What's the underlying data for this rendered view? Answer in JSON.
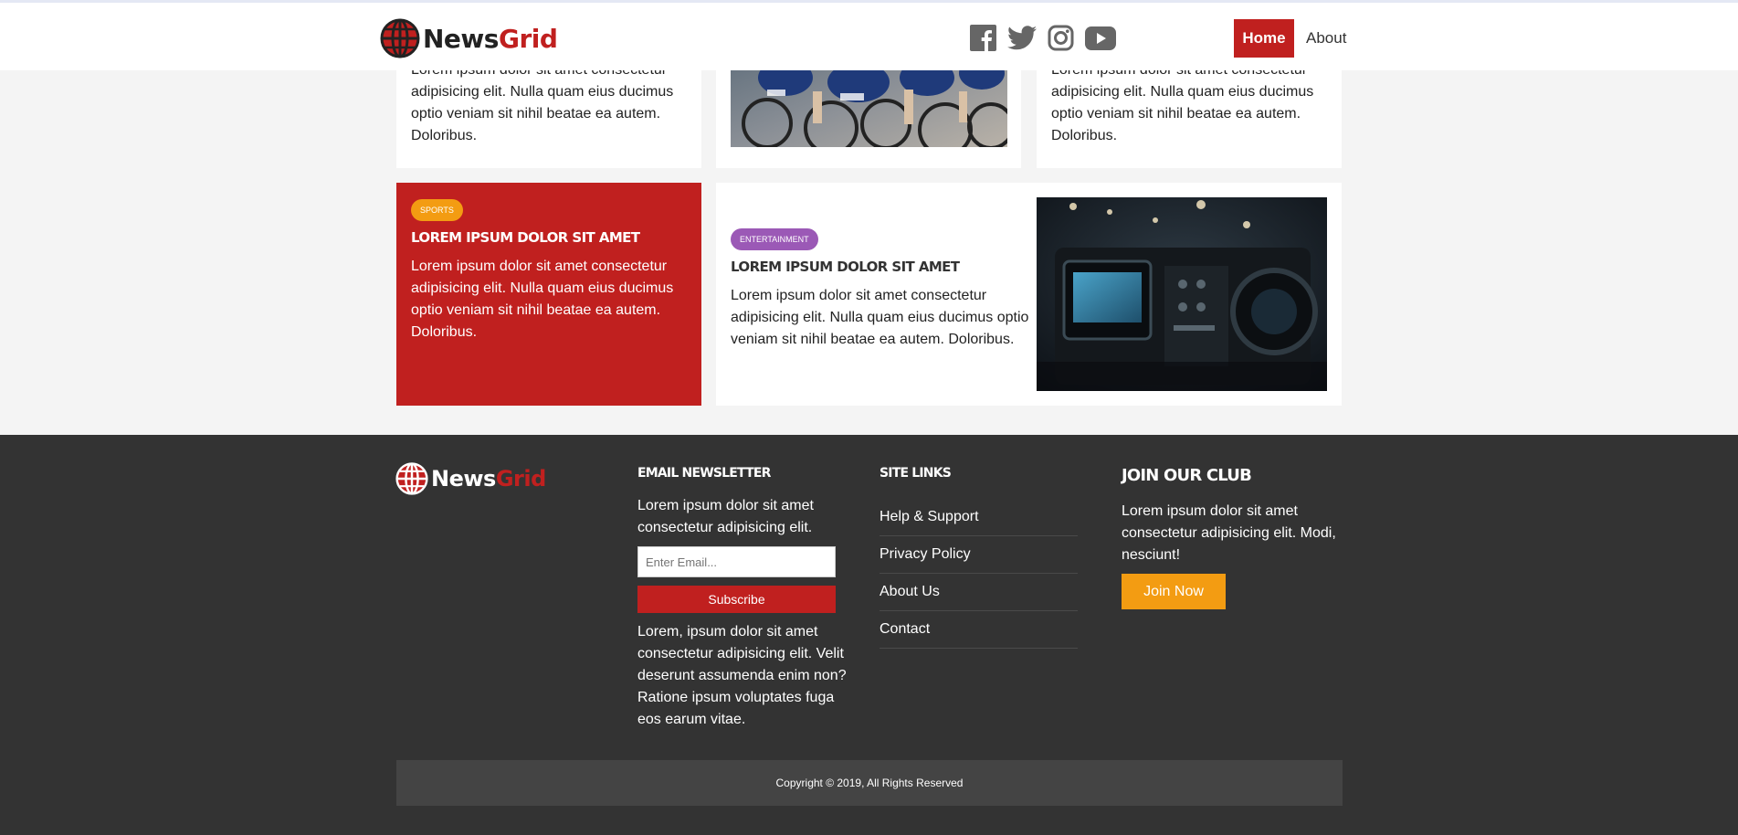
{
  "brand": {
    "name_part1": "News",
    "name_part2": "Grid"
  },
  "social": [
    {
      "icon": "facebook-icon"
    },
    {
      "icon": "twitter-icon"
    },
    {
      "icon": "instagram-icon"
    },
    {
      "icon": "youtube-icon"
    }
  ],
  "nav": {
    "home": "Home",
    "about": "About"
  },
  "cards": {
    "top_left_text": "Lorem ipsum dolor sit amet consectetur adipisicing elit. Nulla quam eius ducimus optio veniam sit nihil beatae ea autem. Doloribus.",
    "top_right_text": "Lorem ipsum dolor sit amet consectetur adipisicing elit. Nulla quam eius ducimus optio veniam sit nihil beatae ea autem. Doloribus.",
    "sports": {
      "badge": "Sports",
      "title": "Lorem ipsum dolor sit amet",
      "text": "Lorem ipsum dolor sit amet consectetur adipisicing elit. Nulla quam eius ducimus optio veniam sit nihil beatae ea autem. Doloribus."
    },
    "entertainment": {
      "badge": "Entertainment",
      "title": "Lorem ipsum dolor sit amet",
      "text": "Lorem ipsum dolor sit amet consectetur adipisicing elit. Nulla quam eius ducimus optio veniam sit nihil beatae ea autem. Doloribus."
    }
  },
  "footer": {
    "newsletter": {
      "heading": "Email Newsletter",
      "intro": "Lorem ipsum dolor sit amet consectetur adipisicing elit.",
      "placeholder": "Enter Email...",
      "button": "Subscribe",
      "outro": "Lorem, ipsum dolor sit amet consectetur adipisicing elit. Velit deserunt assumenda enim non? Ratione ipsum voluptates fuga eos earum vitae."
    },
    "site_links": {
      "heading": "Site Links",
      "items": [
        "Help & Support",
        "Privacy Policy",
        "About Us",
        "Contact"
      ]
    },
    "club": {
      "heading": "Join Our Club",
      "text": "Lorem ipsum dolor sit amet consectetur adipisicing elit. Modi, nesciunt!",
      "button": "Join Now"
    },
    "copyright": "Copyright © 2019, All Rights Reserved"
  },
  "colors": {
    "accent": "#c0201f",
    "orange": "#f39c12",
    "purple": "#9b59b6",
    "footer_bg": "#333333"
  }
}
